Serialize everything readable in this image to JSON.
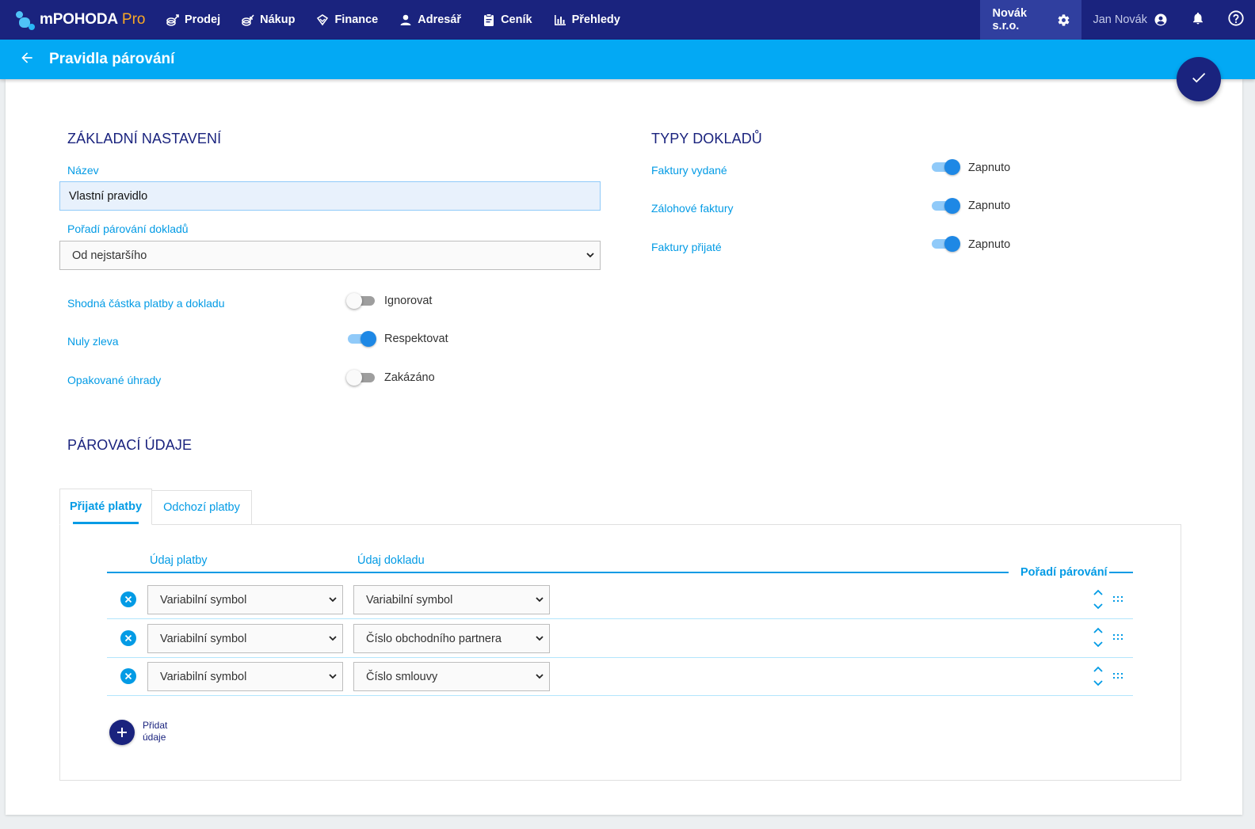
{
  "app": {
    "name": "mPOHODA",
    "edition": "Pro"
  },
  "nav": [
    {
      "label": "Prodej",
      "icon": "sales-icon"
    },
    {
      "label": "Nákup",
      "icon": "purchase-icon"
    },
    {
      "label": "Finance",
      "icon": "finance-icon"
    },
    {
      "label": "Adresář",
      "icon": "person-icon"
    },
    {
      "label": "Ceník",
      "icon": "clipboard-icon"
    },
    {
      "label": "Přehledy",
      "icon": "bar-chart-icon"
    }
  ],
  "company": "Novák s.r.o.",
  "user": "Jan Novák",
  "page": {
    "title": "Pravidla párování"
  },
  "basic": {
    "title": "ZÁKLADNÍ NASTAVENÍ",
    "name_label": "Název",
    "name_value": "Vlastní pravidlo",
    "order_label": "Pořadí párování dokladů",
    "order_value": "Od nejstaršího",
    "toggles": [
      {
        "label": "Shodná částka platby a dokladu",
        "state": "Ignorovat",
        "on": false
      },
      {
        "label": "Nuly zleva",
        "state": "Respektovat",
        "on": true
      },
      {
        "label": "Opakované úhrady",
        "state": "Zakázáno",
        "on": false
      }
    ]
  },
  "doc_types": {
    "title": "TYPY DOKLADŮ",
    "items": [
      {
        "label": "Faktury vydané",
        "state": "Zapnuto",
        "on": true
      },
      {
        "label": "Zálohové faktury",
        "state": "Zapnuto",
        "on": true
      },
      {
        "label": "Faktury přijaté",
        "state": "Zapnuto",
        "on": true
      }
    ]
  },
  "matching": {
    "title": "PÁROVACÍ ÚDAJE",
    "tabs": [
      {
        "label": "Přijaté platby"
      },
      {
        "label": "Odchozí platby"
      }
    ],
    "columns": {
      "payment": "Údaj platby",
      "document": "Údaj dokladu",
      "order": "Pořadí párování"
    },
    "rows": [
      {
        "payment": "Variabilní symbol",
        "document": "Variabilní symbol"
      },
      {
        "payment": "Variabilní symbol",
        "document": "Číslo obchodního partnera"
      },
      {
        "payment": "Variabilní symbol",
        "document": "Číslo smlouvy"
      }
    ],
    "add_label": "Přidat údaje"
  }
}
